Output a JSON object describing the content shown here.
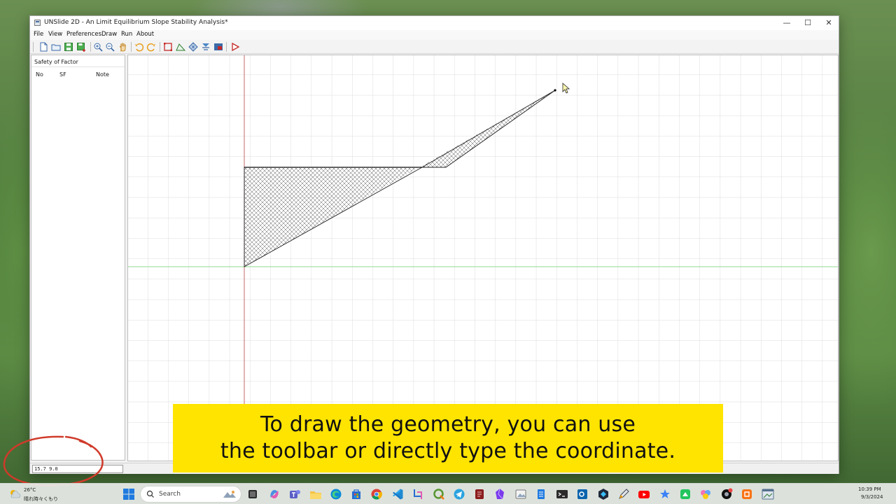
{
  "window": {
    "title": "UNSlide 2D - An Limit Equilibrium Slope Stability Analysis*",
    "controls": {
      "minimize": "—",
      "maximize": "☐",
      "close": "✕"
    }
  },
  "menu": {
    "file": "File",
    "view": "View",
    "preferences": "Preferences",
    "draw": "Draw",
    "run": "Run",
    "about": "About"
  },
  "toolbar_icons": [
    "new-file-icon",
    "open-folder-icon",
    "save-icon",
    "save-as-icon",
    "zoom-in-icon",
    "zoom-out-icon",
    "pan-hand-icon",
    "undo-icon",
    "redo-icon",
    "draw-boundary-icon",
    "draw-polyline-icon",
    "material-grid-icon",
    "water-table-icon",
    "image-icon",
    "run-icon"
  ],
  "panel": {
    "title": "Safety of Factor",
    "columns": {
      "no": "No",
      "sf": "SF",
      "note": "Note"
    }
  },
  "status": {
    "coordinate": "15.7 9.0"
  },
  "caption": {
    "line1": "To draw the geometry, you can use",
    "line2": "the toolbar or directly type the coordinate."
  },
  "taskbar": {
    "weather": {
      "temp": "26°C",
      "desc": "晴れ時々くもり"
    },
    "search_placeholder": "Search",
    "time": "10:39 PM",
    "date": "9/3/2024"
  },
  "colors": {
    "caption_bg": "#ffe400",
    "axis_vertical": "#c46a6a",
    "axis_horizontal": "#8fd88f",
    "grid": "#dcdcdc",
    "annotation_circle": "#d03a2a"
  }
}
